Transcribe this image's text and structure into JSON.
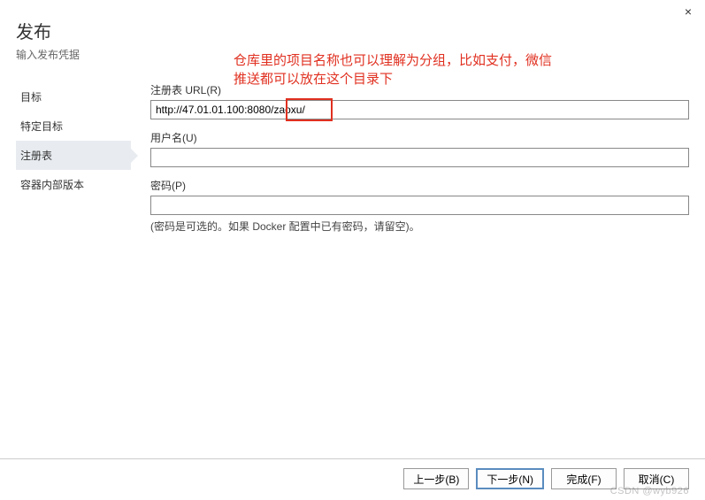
{
  "window": {
    "close": "×"
  },
  "header": {
    "title": "发布",
    "subtitle": "输入发布凭据"
  },
  "sidebar": {
    "items": [
      {
        "label": "目标"
      },
      {
        "label": "特定目标"
      },
      {
        "label": "注册表"
      },
      {
        "label": "容器内部版本"
      }
    ]
  },
  "annotation": {
    "line1": "仓库里的项目名称也可以理解为分组，比如支付，微信",
    "line2": "推送都可以放在这个目录下"
  },
  "form": {
    "registry_url_label": "注册表 URL(R)",
    "registry_url_value": "http://47.01.01.100:8080/zaoxu/",
    "username_label": "用户名(U)",
    "username_value": "",
    "password_label": "密码(P)",
    "password_value": "",
    "password_hint": "(密码是可选的。如果 Docker 配置中已有密码，请留空)。"
  },
  "footer": {
    "prev": "上一步(B)",
    "next": "下一步(N)",
    "finish": "完成(F)",
    "cancel": "取消(C)"
  },
  "watermark": "CSDN @wyb926"
}
